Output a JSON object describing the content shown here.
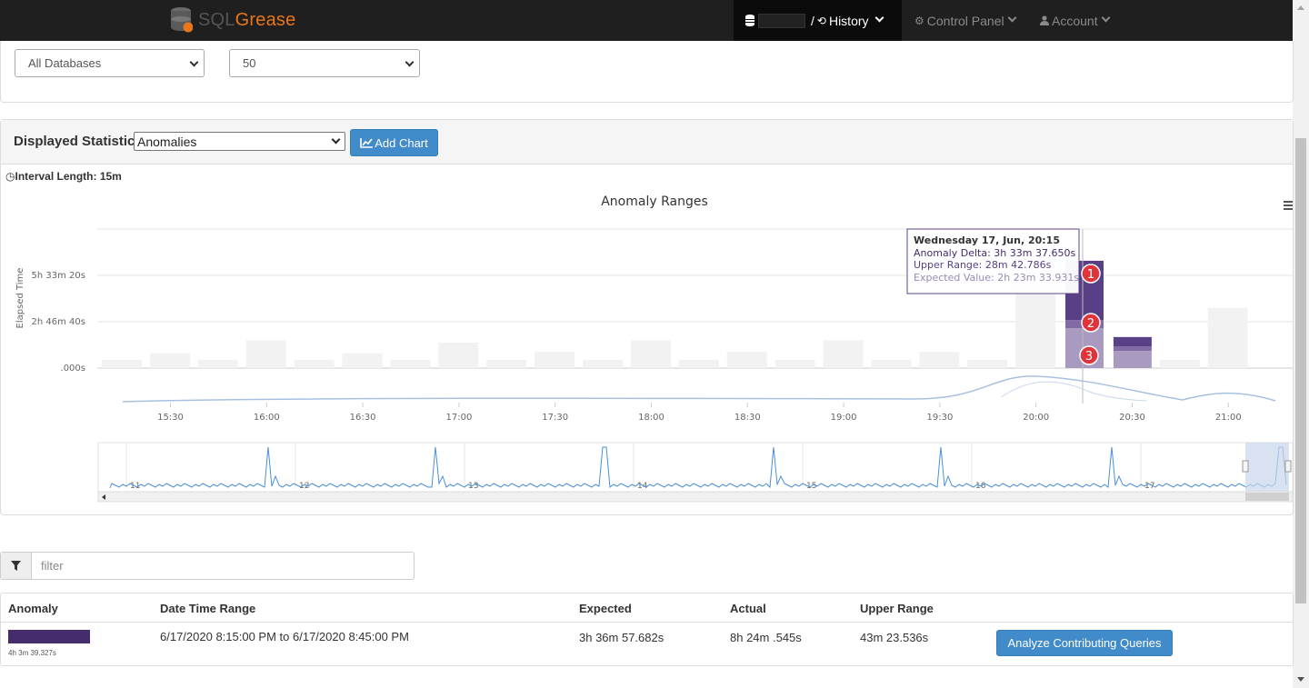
{
  "app": {
    "logo_sql": "SQL",
    "logo_grease": "Grease",
    "brand_color": "#e8761b"
  },
  "nav": {
    "separator": "/",
    "history_label": "History",
    "control_panel_label": "Control Panel",
    "account_label": "Account"
  },
  "filters": {
    "database_select": "All Databases",
    "count_select": "50"
  },
  "chart_panel": {
    "displayed_statistic_label": "Displayed Statistic",
    "statistic_value": "Anomalies",
    "add_chart_label": "Add Chart",
    "interval_label": "Interval Length: 15m",
    "menu_icon": "hamburger-icon"
  },
  "chart_data": {
    "type": "bar",
    "title": "Anomaly Ranges",
    "ylabel": "Elapsed Time",
    "y_tick_labels": [
      ".000s",
      "2h 46m 40s",
      "5h 33m 20s"
    ],
    "y_tick_values_s": [
      0,
      10000,
      20000
    ],
    "ylim_s": [
      0,
      30000
    ],
    "x_tick_labels": [
      "15:30",
      "16:00",
      "16:30",
      "17:00",
      "17:30",
      "18:00",
      "18:30",
      "19:00",
      "19:30",
      "20:00",
      "20:30",
      "21:00"
    ],
    "x_start": "15:15",
    "x_end": "21:30",
    "x_step_min": 15,
    "normal_bars_s": [
      1800,
      3200,
      1800,
      6000,
      1800,
      3200,
      1800,
      5500,
      1800,
      3500,
      1800,
      6000,
      1800,
      3500,
      1800,
      6000,
      1800,
      3500,
      1800,
      21000,
      0,
      0,
      1800,
      13000
    ],
    "anomaly_bars": [
      {
        "time": "20:15",
        "expected_s": 8614,
        "upper_range_s": 1723,
        "anomaly_delta_s": 12818
      },
      {
        "time": "20:30",
        "expected_s": 3700,
        "upper_range_s": 1000,
        "anomaly_delta_s": 2000
      }
    ],
    "tooltip": {
      "title": "Wednesday 17, Jun, 20:15",
      "anomaly_delta": "Anomaly Delta: 3h 33m 37.650s",
      "upper_range": "Upper Range: 28m 42.786s",
      "expected_value": "Expected Value: 2h 23m 33.931s"
    },
    "markers": [
      "1",
      "2",
      "3"
    ],
    "navigator_labels": [
      "11",
      "12",
      "13",
      "14",
      "15",
      "16",
      "17"
    ],
    "colors": {
      "anomaly": "#583f86",
      "upper_range": "#836aa6",
      "expected": "#a99abf",
      "normal": "#f2f2f2",
      "marker": "#e0343a"
    }
  },
  "filter": {
    "placeholder": "filter",
    "icon": "filter-icon"
  },
  "table": {
    "headers": [
      "Anomaly",
      "Date Time Range",
      "Expected",
      "Actual",
      "Upper Range"
    ],
    "rows": [
      {
        "anomaly_sub": "4h 3m 39.327s",
        "date_range": "6/17/2020 8:15:00 PM to 6/17/2020 8:45:00 PM",
        "expected": "3h 36m 57.682s",
        "actual": "8h 24m .545s",
        "upper_range": "43m 23.536s",
        "action": "Analyze Contributing Queries"
      }
    ]
  }
}
